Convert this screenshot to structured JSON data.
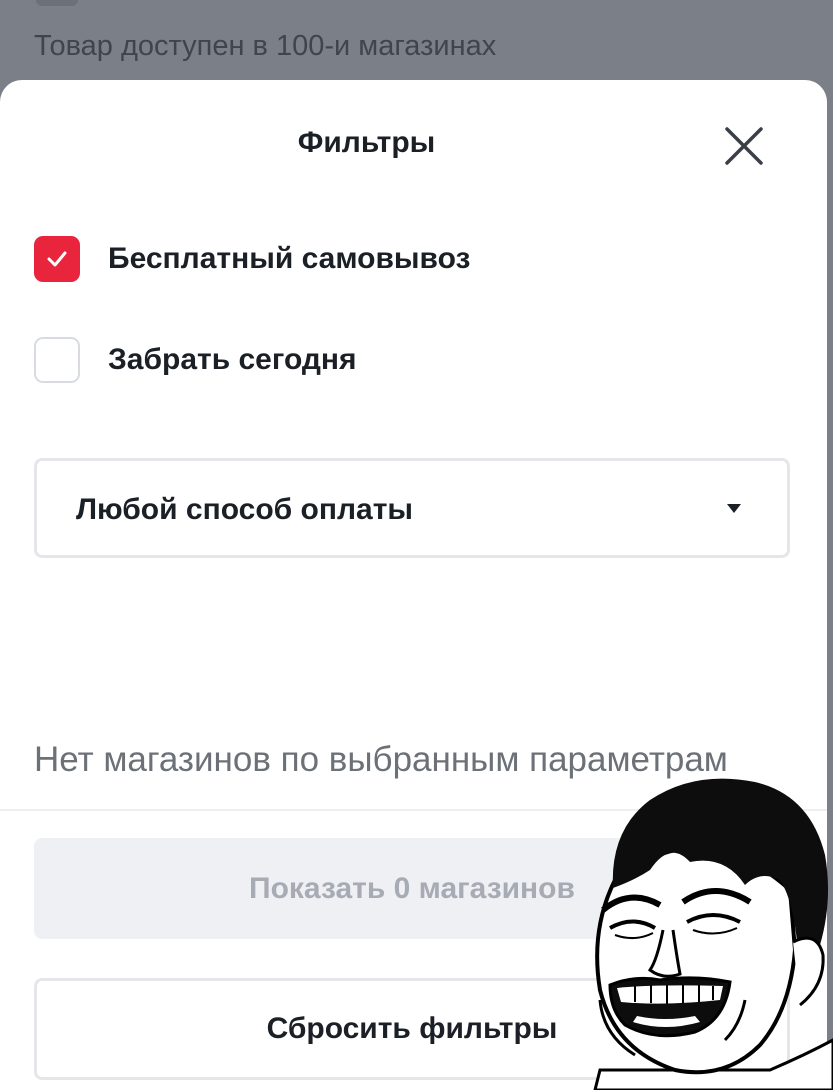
{
  "background": {
    "text": "Товар доступен в 100-и магазинах"
  },
  "sheet": {
    "title": "Фильтры",
    "close_icon": "close-icon",
    "filters": [
      {
        "label": "Бесплатный самовывоз",
        "checked": true
      },
      {
        "label": "Забрать сегодня",
        "checked": false
      }
    ],
    "payment_select": {
      "value": "Любой способ оплаты",
      "icon": "triangle-down-icon"
    },
    "empty_message": "Нет магазинов по выбранным параметрам",
    "show_button": {
      "label": "Показать 0 магазинов",
      "disabled": true
    },
    "reset_button": {
      "label": "Сбросить фильтры"
    }
  },
  "colors": {
    "accent": "#e8253c",
    "overlay": "#7b8088",
    "text": "#1b1f26",
    "muted_text": "#6c7178",
    "disabled_bg": "#eef0f4",
    "disabled_text": "#a7abb3"
  },
  "overlay_image": "laughing-meme-face"
}
